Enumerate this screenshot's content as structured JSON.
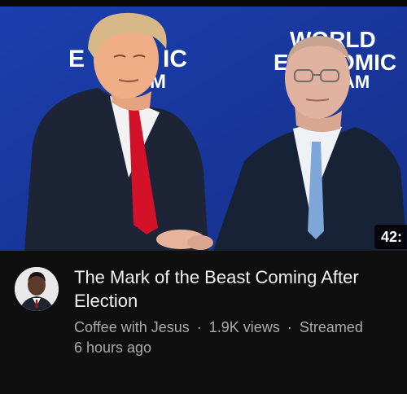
{
  "video": {
    "duration": "42:",
    "title": "The Mark of the Beast Coming After Election",
    "channel": "Coffee with Jesus",
    "views": "1.9K views",
    "separator": "·",
    "streamed_prefix": "Streamed",
    "streamed_ago": "6 hours ago"
  },
  "thumbnail": {
    "banner_left_partial": "E",
    "banner_left_partial_2": "IC",
    "banner_left_partial_3": "M",
    "banner_right_line1": "WORLD",
    "banner_right_line2": "E",
    "banner_right_line3": "OMIC",
    "banner_right_line4": "AM",
    "background_color": "#1b3fae",
    "tie_left_color": "#d3122a",
    "tie_right_color": "#7fa6d8"
  },
  "colors": {
    "page_bg": "#0f0f0f",
    "title": "#f1f1f1",
    "secondary": "#aaaaaa"
  }
}
